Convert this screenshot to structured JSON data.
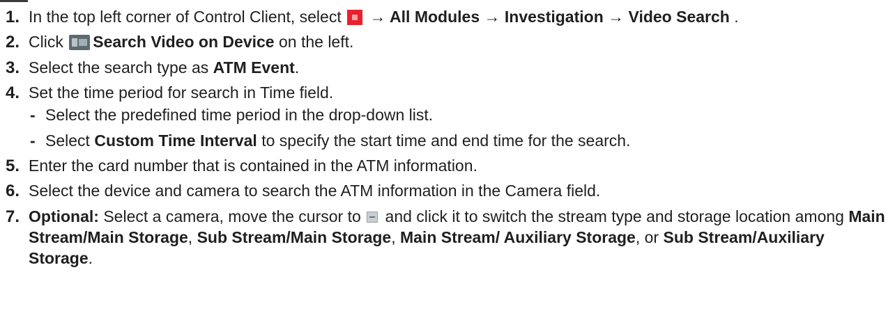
{
  "steps": [
    {
      "num": "1.",
      "t1": "In the top left corner of Control Client, select ",
      "b1": " → All Modules → Investigation → Video Search",
      "t2": " ."
    },
    {
      "num": "2.",
      "t1": "Click ",
      "b1": "Search Video on Device",
      "t2": " on the left."
    },
    {
      "num": "3.",
      "t1": "Select the search type as ",
      "b1": "ATM Event",
      "t2": "."
    },
    {
      "num": "4.",
      "t1": "Set the time period for search in Time field.",
      "sub": [
        {
          "dash": "-",
          "t1": "Select the predefined time period in the drop-down list."
        },
        {
          "dash": "-",
          "t1": "Select ",
          "b1": "Custom Time Interval",
          "t2": " to specify the start time and end time for the search."
        }
      ]
    },
    {
      "num": "5.",
      "t1": "Enter the card number that is contained in the ATM information."
    },
    {
      "num": "6.",
      "t1": "Select the device and camera to search the ATM information in the Camera field."
    },
    {
      "num": "7.",
      "b0": "Optional:",
      "t1": " Select a camera, move the cursor to ",
      "t2": " and click it to switch the stream type and storage location among ",
      "b1": "Main Stream/Main Storage",
      "t3": ", ",
      "b2": "Sub Stream/Main Storage",
      "t4": ", ",
      "b3": "Main Stream/ Auxiliary Storage",
      "t5": ", or ",
      "b4": "Sub Stream/Auxiliary Storage",
      "t6": "."
    }
  ],
  "icons": {
    "step1": "modules-menu-icon",
    "step2": "device-search-icon",
    "step7": "stream-switch-icon"
  }
}
